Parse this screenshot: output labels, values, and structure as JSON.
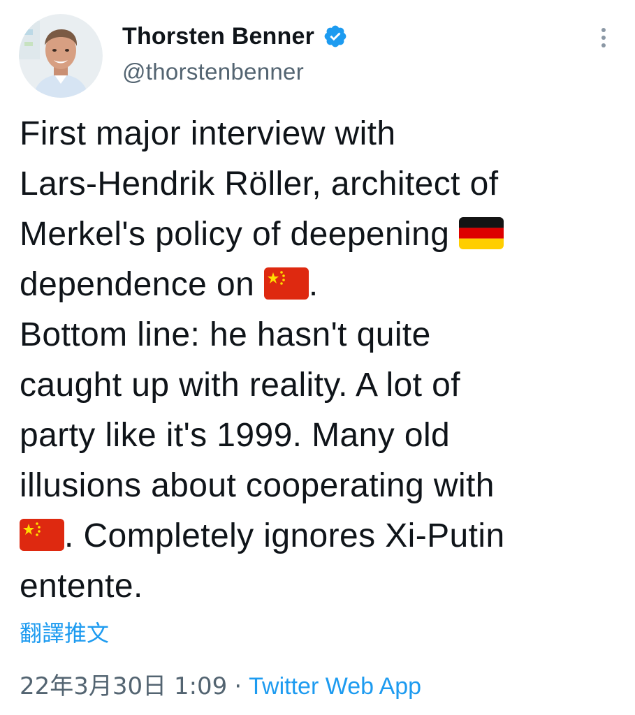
{
  "author": {
    "display_name": "Thorsten Benner",
    "handle": "@thorstenbenner",
    "verified": true
  },
  "tweet": {
    "lines": [
      "First major interview with",
      "Lars-Hendrik Röller, architect of",
      "Merkel's policy of deepening ",
      "dependence on ",
      "Bottom line: he hasn't quite",
      "caught up with reality. A lot of",
      "party like it's 1999. Many old",
      "illusions about cooperating with",
      ". Completely ignores Xi-Putin",
      "entente."
    ],
    "period": ".",
    "flags": [
      "germany-flag-icon",
      "china-flag-icon",
      "china-flag-icon"
    ]
  },
  "translate_label": "翻譯推文",
  "meta": {
    "timestamp": "22年3月30日 1:09",
    "separator": "·",
    "source": "Twitter Web App"
  },
  "colors": {
    "text": "#0f1419",
    "secondary": "#536471",
    "link": "#1d9bf0",
    "verified": "#1d9bf0"
  }
}
